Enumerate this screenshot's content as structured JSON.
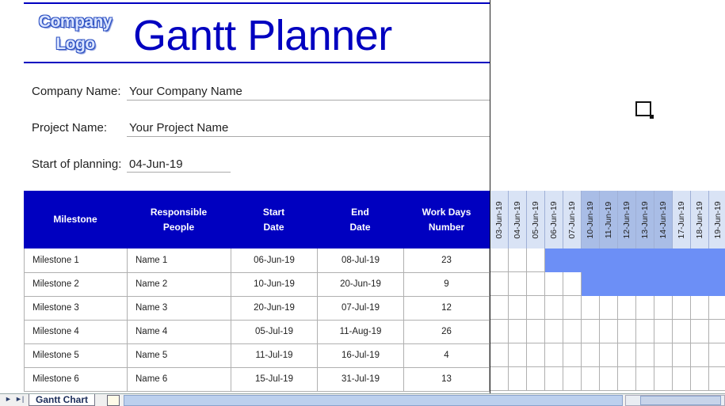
{
  "header": {
    "logo_line1": "Company",
    "logo_line2": "Logo",
    "title": "Gantt Planner"
  },
  "info": {
    "company_label": "Company Name:",
    "company_value": "Your Company Name",
    "project_label": "Project Name:",
    "project_value": "Your Project Name",
    "start_label": "Start of planning:",
    "start_value": "04-Jun-19"
  },
  "table": {
    "headers": [
      "Milestone",
      "Responsible\nPeople",
      "Start\nDate",
      "End\nDate",
      "Work Days\nNumber"
    ],
    "rows": [
      {
        "milestone": "Milestone 1",
        "person": "Name 1",
        "start": "06-Jun-19",
        "end": "08-Jul-19",
        "days": "23"
      },
      {
        "milestone": "Milestone 2",
        "person": "Name 2",
        "start": "10-Jun-19",
        "end": "20-Jun-19",
        "days": "9"
      },
      {
        "milestone": "Milestone 3",
        "person": "Name 3",
        "start": "20-Jun-19",
        "end": "07-Jul-19",
        "days": "12"
      },
      {
        "milestone": "Milestone 4",
        "person": "Name 4",
        "start": "05-Jul-19",
        "end": "11-Aug-19",
        "days": "26"
      },
      {
        "milestone": "Milestone 5",
        "person": "Name 5",
        "start": "11-Jul-19",
        "end": "16-Jul-19",
        "days": "4"
      },
      {
        "milestone": "Milestone 6",
        "person": "Name 6",
        "start": "15-Jul-19",
        "end": "31-Jul-19",
        "days": "13"
      }
    ]
  },
  "gantt": {
    "dates": [
      "03-Jun-19",
      "04-Jun-19",
      "05-Jun-19",
      "06-Jun-19",
      "07-Jun-19",
      "10-Jun-19",
      "11-Jun-19",
      "12-Jun-19",
      "13-Jun-19",
      "14-Jun-19",
      "17-Jun-19",
      "18-Jun-19",
      "19-Jun-19"
    ],
    "header_colors": [
      "#d9e3f5",
      "#d9e3f5",
      "#d9e3f5",
      "#d9e3f5",
      "#d9e3f5",
      "#a9bde6",
      "#a9bde6",
      "#a9bde6",
      "#a9bde6",
      "#a9bde6",
      "#d9e3f5",
      "#d9e3f5",
      "#d9e3f5"
    ],
    "bars": [
      {
        "row": 0,
        "start_index": 3,
        "end_index": 12
      },
      {
        "row": 1,
        "start_index": 5,
        "end_index": 12
      }
    ],
    "bar_color": "#6c8ff6"
  },
  "sheet_tabs": {
    "active": "Gantt Chart"
  }
}
